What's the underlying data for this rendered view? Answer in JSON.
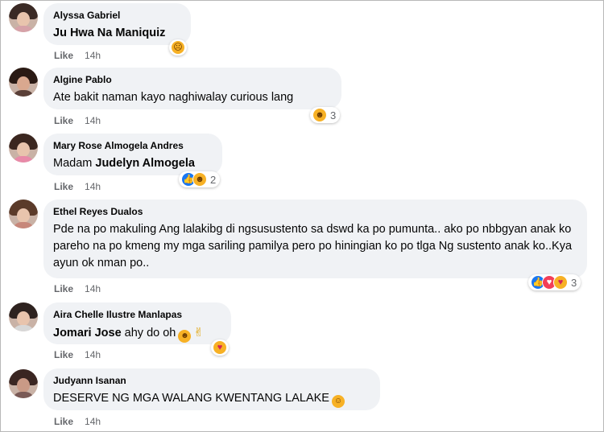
{
  "comments": [
    {
      "author": "Alyssa Gabriel",
      "mention": "Ju Hwa Na Maniquiz",
      "text": "",
      "like": "Like",
      "time": "14h",
      "reactions": [
        "sad-icon"
      ],
      "reaction_count": ""
    },
    {
      "author": "Algine Pablo",
      "mention": "",
      "text": "Ate bakit naman kayo naghiwalay curious lang",
      "like": "Like",
      "time": "14h",
      "reactions": [
        "haha-icon"
      ],
      "reaction_count": "3"
    },
    {
      "author": "Mary Rose Almogela Andres",
      "text_prefix": "Madam ",
      "mention": "Judelyn Almogela",
      "like": "Like",
      "time": "14h",
      "reactions": [
        "like-icon",
        "haha-icon"
      ],
      "reaction_count": "2"
    },
    {
      "author": "Ethel Reyes Dualos",
      "text": "Pde na po makuling Ang lalakibg di ngsusustento sa dswd ka po pumunta.. ako po nbbgyan anak ko pareho na po kmeng my mga sariling pamilya pero po hiningian ko po tlga Ng sustento anak ko..Kya ayun ok nman po..",
      "like": "Like",
      "time": "14h",
      "reactions": [
        "like-icon",
        "love-icon",
        "care-icon"
      ],
      "reaction_count": "3"
    },
    {
      "author": "Aira Chelle Ilustre Manlapas",
      "mention": "Jomari Jose",
      "text": " ahy do oh",
      "like": "Like",
      "time": "14h",
      "reactions": [
        "care-icon"
      ],
      "reaction_count": ""
    },
    {
      "author": "Judyann Isanan",
      "text": "DESERVE NG MGA WALANG KWENTANG LALAKE",
      "like": "Like",
      "time": "14h"
    }
  ],
  "colors": {
    "bubble": "#f0f2f5",
    "secondary_text": "#65676b",
    "like_blue": "#1877f2",
    "love_red": "#f33e58",
    "emoji_yellow": "#f7b125"
  }
}
